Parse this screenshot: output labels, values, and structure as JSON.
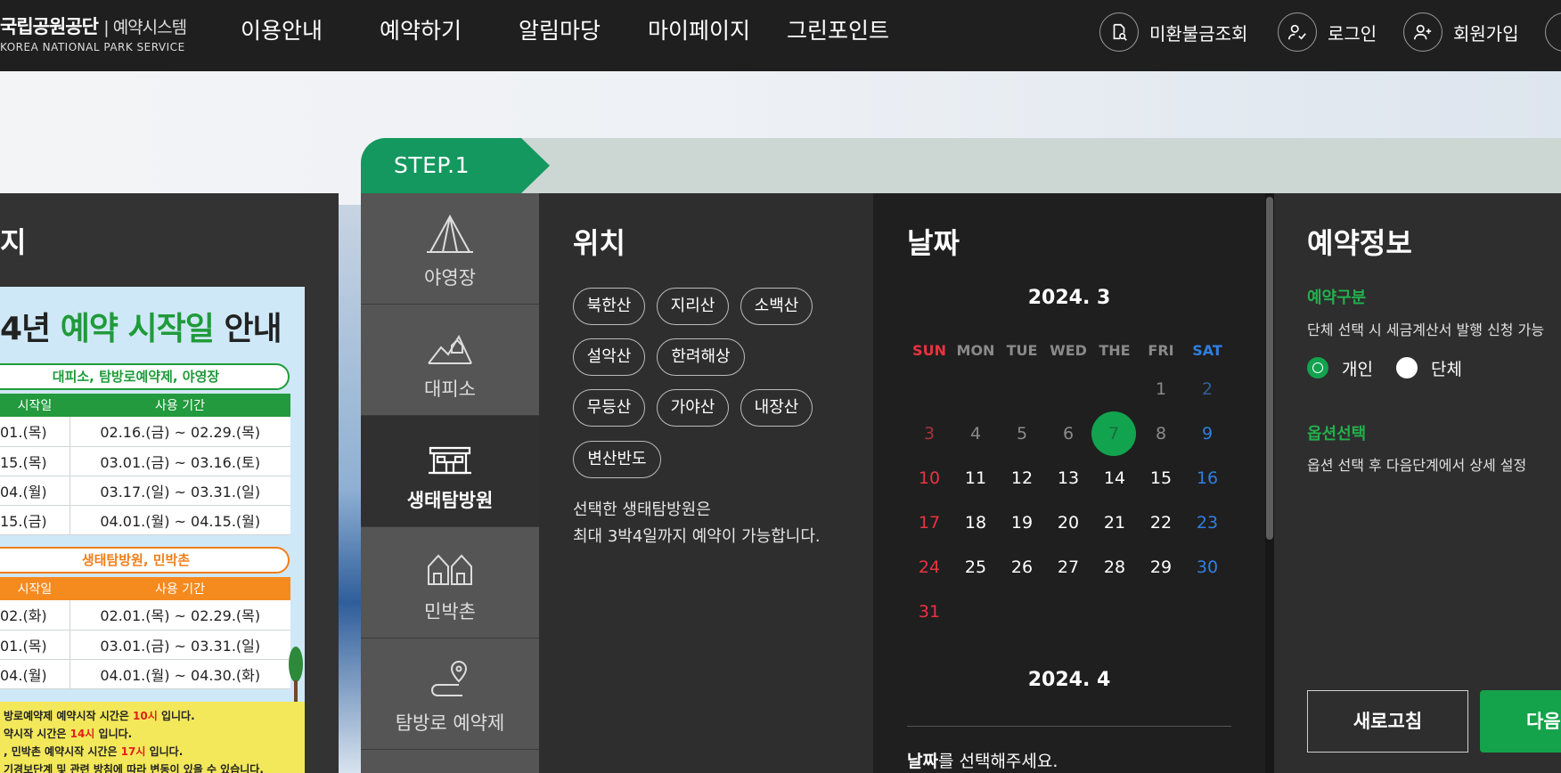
{
  "header": {
    "logo_name": "국립공원공단",
    "logo_system": "예약시스템",
    "logo_en": "KOREA NATIONAL PARK SERVICE",
    "nav": [
      "이용안내",
      "예약하기",
      "알림마당",
      "마이페이지",
      "그린포인트"
    ],
    "util": [
      "미환불금조회",
      "로그인",
      "회원가입"
    ]
  },
  "notice": {
    "title_fragment": "지",
    "heading_pre": "4년 ",
    "heading_green": "예약 시작일",
    "heading_post": " 안내",
    "pill1": "대피소, 탐방로예약제, 야영장",
    "table1": {
      "headers": [
        "시작일",
        "사용 기간"
      ],
      "rows": [
        [
          "01.(목)",
          "02.16.(금) ~ 02.29.(목)"
        ],
        [
          "15.(목)",
          "03.01.(금) ~ 03.16.(토)"
        ],
        [
          "04.(월)",
          "03.17.(일) ~ 03.31.(일)"
        ],
        [
          "15.(금)",
          "04.01.(월) ~ 04.15.(월)"
        ]
      ]
    },
    "pill2": "생태탐방원, 민박촌",
    "table2": {
      "headers": [
        "시작일",
        "사용 기간"
      ],
      "rows": [
        [
          "02.(화)",
          "02.01.(목) ~ 02.29.(목)"
        ],
        [
          "01.(목)",
          "03.01.(금) ~ 03.31.(일)"
        ],
        [
          "04.(월)",
          "04.01.(월) ~ 04.30.(화)"
        ]
      ]
    },
    "foot": {
      "line1_pre": "방로예약제 예약시작 시간은 ",
      "line1_red": "10시",
      "line1_post": " 입니다.",
      "line2_pre": "약시작 시간은 ",
      "line2_red": "14시",
      "line2_post": " 입니다.",
      "line3_pre": ", 민박촌 예약시작 시간은 ",
      "line3_red": "17시",
      "line3_post": " 입니다.",
      "line4": "기경보단계 및 관련 방침에 따라 변동이 있을 수 있습니다."
    }
  },
  "step": {
    "label": "STEP.1"
  },
  "categories": [
    {
      "label": "야영장",
      "icon": "tent-icon",
      "active": false
    },
    {
      "label": "대피소",
      "icon": "mountain-shelter-icon",
      "active": false
    },
    {
      "label": "생태탐방원",
      "icon": "eco-center-building-icon",
      "active": true
    },
    {
      "label": "민박촌",
      "icon": "houses-icon",
      "active": false
    },
    {
      "label": "탐방로 예약제",
      "icon": "trail-route-icon",
      "active": false
    }
  ],
  "location": {
    "title": "위치",
    "chips": [
      "북한산",
      "지리산",
      "소백산",
      "설악산",
      "한려해상",
      "무등산",
      "가야산",
      "내장산",
      "변산반도"
    ],
    "note1": "선택한 생태탐방원은",
    "note2": "최대 3박4일까지 예약이 가능합니다."
  },
  "date": {
    "title": "날짜",
    "month1": "2024. 3",
    "weekdays": [
      "SUN",
      "MON",
      "TUE",
      "WED",
      "THE",
      "FRI",
      "SAT"
    ],
    "selected_day": "7",
    "month2": "2024. 4",
    "msg_bold": "날짜",
    "msg_rest": "를 선택해주세요."
  },
  "info": {
    "title": "예약정보",
    "type_label": "예약구분",
    "type_desc": "단체 선택 시 세금계산서 발행 신청 가능",
    "radio_personal": "개인",
    "radio_group": "단체",
    "option_label": "옵션선택",
    "option_desc": "옵션 선택 후 다음단계에서 상세 설정",
    "btn_refresh": "새로고침",
    "btn_next": "다음"
  },
  "colors": {
    "accent": "#14985f",
    "selected": "#12a34f",
    "sunday": "#ea3340",
    "saturday": "#2f7fe2"
  }
}
